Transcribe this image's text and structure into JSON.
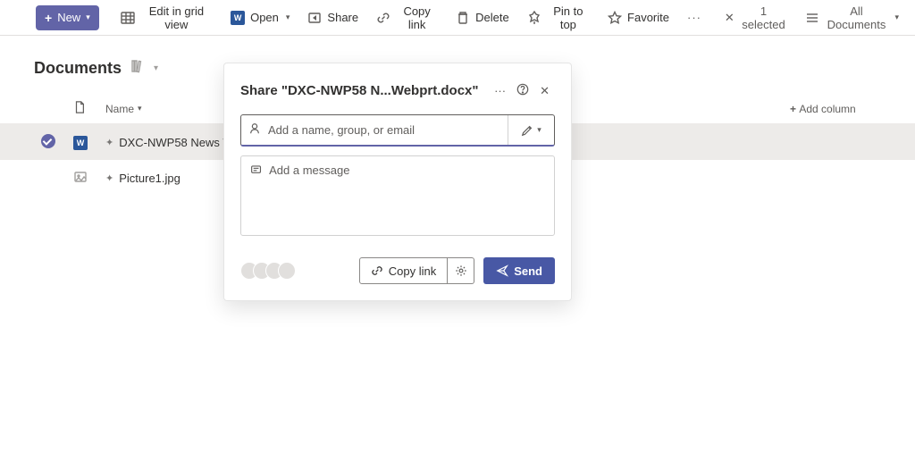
{
  "toolbar": {
    "new_label": "New",
    "edit_grid_label": "Edit in grid view",
    "open_label": "Open",
    "share_label": "Share",
    "copylink_label": "Copy link",
    "delete_label": "Delete",
    "pin_label": "Pin to top",
    "favorite_label": "Favorite",
    "selected_label": "1 selected",
    "view_label": "All Documents"
  },
  "library": {
    "title": "Documents",
    "columns": {
      "name": "Name",
      "add": "Add column"
    },
    "rows": [
      {
        "file": "DXC-NWP58 News Web…",
        "type": "docx",
        "selected": true
      },
      {
        "file": "Picture1.jpg",
        "type": "jpg",
        "selected": false
      }
    ]
  },
  "share_dialog": {
    "title": "Share \"DXC-NWP58 N...Webprt.docx\"",
    "recipient_placeholder": "Add a name, group, or email",
    "message_placeholder": "Add a message",
    "copy_link_label": "Copy link",
    "send_label": "Send"
  }
}
